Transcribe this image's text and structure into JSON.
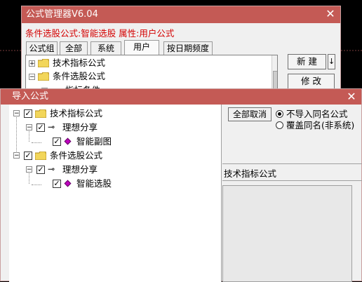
{
  "manager": {
    "title": "公式管理器V6.04",
    "info": "条件选股公式:智能选股  属性:用户公式",
    "tabs": [
      "公式组",
      "全部",
      "系统",
      "用户",
      "按日期频度"
    ],
    "active_tab": "用户",
    "tree": [
      "技术指标公式",
      "条件选股公式",
      "指标条件"
    ],
    "new_button": "新  建",
    "new_arrow": "↓",
    "modify_button": "修  改"
  },
  "import": {
    "title": "导入公式",
    "tree": {
      "group1": "技术指标公式",
      "group1_sub": "理想分享",
      "group1_item": "智能副图",
      "group2": "条件选股公式",
      "group2_sub": "理想分享",
      "group2_item": "智能选股"
    },
    "cancel_all_button": "全部取消",
    "radio_no_import": "不导入同名公式",
    "radio_overwrite": "覆盖同名(非系统)",
    "selected_type": "技术指标公式",
    "check_mark": "✓",
    "expander": "−",
    "expander_plus": "+",
    "close": "✕"
  },
  "colors": {
    "title_bar": "#c45a55",
    "info_text": "#d40000",
    "folder": "#f2d65a",
    "diamond": "#c000c0"
  }
}
